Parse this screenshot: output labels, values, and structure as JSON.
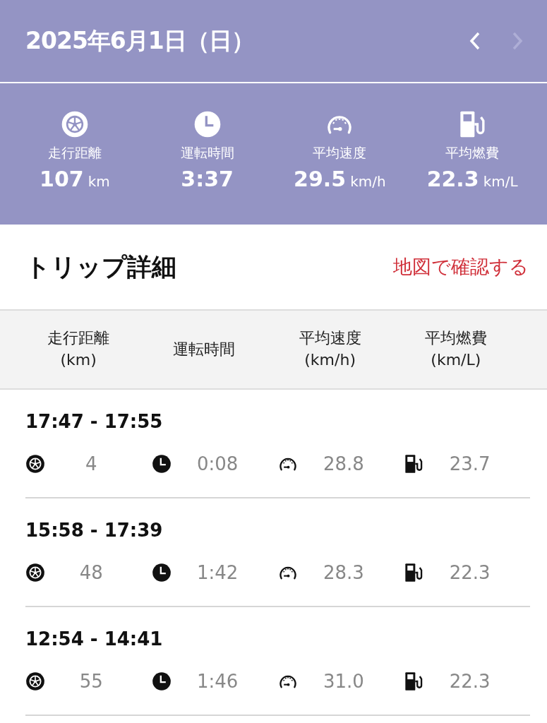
{
  "header": {
    "date": "2025年6月1日（日）",
    "prev": {
      "disabled": false
    },
    "next": {
      "disabled": true
    }
  },
  "summary": [
    {
      "kind": "distance",
      "label": "走行距離",
      "value": "107",
      "unit": "km"
    },
    {
      "kind": "time",
      "label": "運転時間",
      "value": "3:37"
    },
    {
      "kind": "speed",
      "label": "平均速度",
      "value": "29.5",
      "unit": "km/h"
    },
    {
      "kind": "fuel",
      "label": "平均燃費",
      "value": "22.3",
      "unit": "km/L"
    }
  ],
  "section": {
    "title": "トリップ詳細",
    "link": "地図で確認する"
  },
  "table": {
    "columns": [
      {
        "label": "走行距離",
        "unit": "(km)"
      },
      {
        "label": "運転時間"
      },
      {
        "label": "平均速度",
        "unit": "(km/h)"
      },
      {
        "label": "平均燃費",
        "unit": "(km/L)"
      }
    ],
    "rows": [
      {
        "time": "17:47 - 17:55",
        "cells": [
          {
            "kind": "distance",
            "value": "4"
          },
          {
            "kind": "time",
            "value": "0:08"
          },
          {
            "kind": "speed",
            "value": "28.8"
          },
          {
            "kind": "fuel",
            "value": "23.7"
          }
        ]
      },
      {
        "time": "15:58 - 17:39",
        "cells": [
          {
            "kind": "distance",
            "value": "48"
          },
          {
            "kind": "time",
            "value": "1:42"
          },
          {
            "kind": "speed",
            "value": "28.3"
          },
          {
            "kind": "fuel",
            "value": "22.3"
          }
        ]
      },
      {
        "time": "12:54 - 14:41",
        "cells": [
          {
            "kind": "distance",
            "value": "55"
          },
          {
            "kind": "time",
            "value": "1:46"
          },
          {
            "kind": "speed",
            "value": "31.0"
          },
          {
            "kind": "fuel",
            "value": "22.3"
          }
        ]
      }
    ]
  }
}
